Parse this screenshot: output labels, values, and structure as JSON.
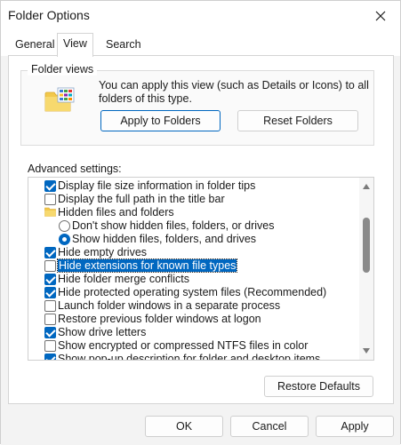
{
  "window": {
    "title": "Folder Options"
  },
  "tabs": [
    {
      "label": "General",
      "active": false
    },
    {
      "label": "View",
      "active": true
    },
    {
      "label": "Search",
      "active": false
    }
  ],
  "folder_views": {
    "group_title": "Folder views",
    "description": "You can apply this view (such as Details or Icons) to all folders of this type.",
    "apply_button": "Apply to Folders",
    "reset_button": "Reset Folders"
  },
  "advanced": {
    "label": "Advanced settings:",
    "items": [
      {
        "label": "Display file size information in folder tips",
        "control": "checkbox",
        "checked": true,
        "level": 0
      },
      {
        "label": "Display the full path in the title bar",
        "control": "checkbox",
        "checked": false,
        "level": 0
      },
      {
        "label": "Hidden files and folders",
        "control": "folder-icon",
        "level": 0
      },
      {
        "label": "Don't show hidden files, folders, or drives",
        "control": "radio",
        "checked": false,
        "level": 1
      },
      {
        "label": "Show hidden files, folders, and drives",
        "control": "radio",
        "checked": true,
        "level": 1
      },
      {
        "label": "Hide empty drives",
        "control": "checkbox",
        "checked": true,
        "level": 0
      },
      {
        "label": "Hide extensions for known file types",
        "control": "checkbox",
        "checked": false,
        "level": 0,
        "selected": true
      },
      {
        "label": "Hide folder merge conflicts",
        "control": "checkbox",
        "checked": true,
        "level": 0
      },
      {
        "label": "Hide protected operating system files (Recommended)",
        "control": "checkbox",
        "checked": true,
        "level": 0
      },
      {
        "label": "Launch folder windows in a separate process",
        "control": "checkbox",
        "checked": false,
        "level": 0
      },
      {
        "label": "Restore previous folder windows at logon",
        "control": "checkbox",
        "checked": false,
        "level": 0
      },
      {
        "label": "Show drive letters",
        "control": "checkbox",
        "checked": true,
        "level": 0
      },
      {
        "label": "Show encrypted or compressed NTFS files in color",
        "control": "checkbox",
        "checked": false,
        "level": 0
      },
      {
        "label": "Show pop-up description for folder and desktop items",
        "control": "checkbox",
        "checked": true,
        "level": 0
      }
    ],
    "restore_defaults_button": "Restore Defaults"
  },
  "footer": {
    "ok_button": "OK",
    "cancel_button": "Cancel",
    "apply_button": "Apply"
  },
  "colors": {
    "accent": "#0067c0",
    "selection_bg": "#0067c0",
    "dialog_bg": "#f3f3f3",
    "panel_bg": "#ffffff"
  },
  "icons": {
    "close": "close-icon",
    "folder_views": "folder-grid-icon",
    "hidden_files": "folder-icon",
    "scroll_up": "chevron-up-icon",
    "scroll_down": "chevron-down-icon"
  }
}
